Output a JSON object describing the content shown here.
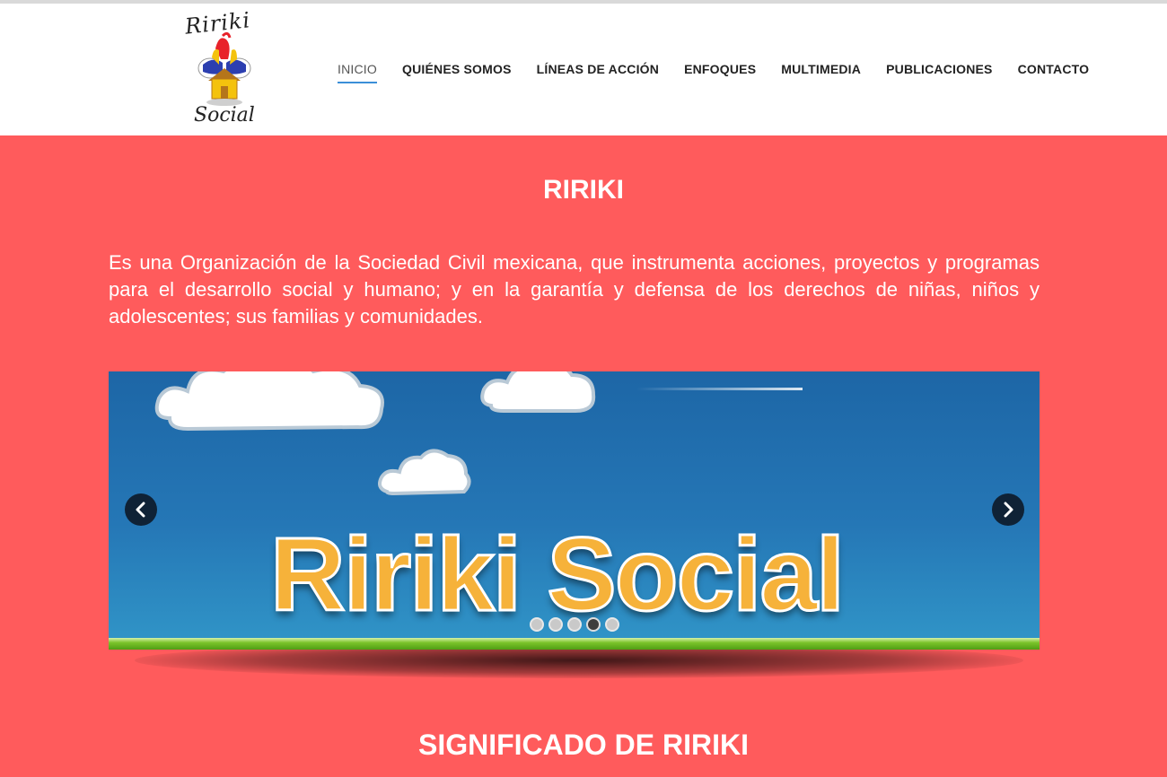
{
  "logo": {
    "top_text": "Ririki",
    "bottom_text": "Social"
  },
  "nav": {
    "items": [
      {
        "label": "INICIO",
        "active": true
      },
      {
        "label": "QUIÉNES SOMOS"
      },
      {
        "label": "LÍNEAS DE ACCIÓN"
      },
      {
        "label": "ENFOQUES"
      },
      {
        "label": "MULTIMEDIA"
      },
      {
        "label": "PUBLICACIONES"
      },
      {
        "label": "CONTACTO"
      }
    ]
  },
  "main": {
    "title": "RIRIKI",
    "intro": "Es una Organización de la Sociedad Civil mexicana, que instrumenta acciones, proyectos y programas para el desarrollo social y humano; y en la garantía y defensa de los derechos de niñas, niños y adolescentes; sus familias y comunidades.",
    "subtitle": "SIGNIFICADO DE RIRIKI"
  },
  "slider": {
    "slide_text": "Ririki Social",
    "dots_count": 5,
    "active_dot": 4
  },
  "colors": {
    "page_background": "#ff5b5c",
    "nav_active_underline": "#3b8fd8",
    "slide_text": "#f6b23a",
    "slider_sky": "#2577b6"
  },
  "icons": {
    "prev": "chevron-left-icon",
    "next": "chevron-right-icon"
  }
}
